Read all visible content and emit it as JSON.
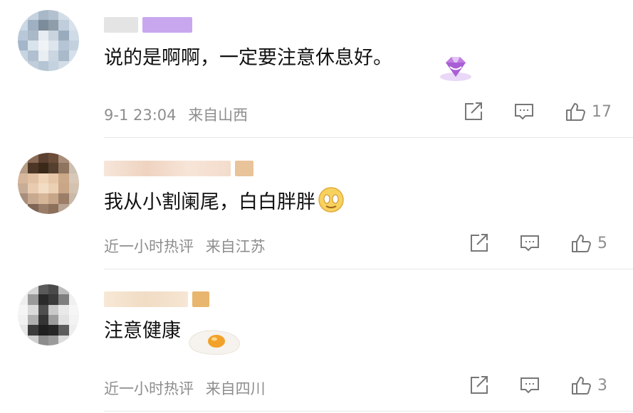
{
  "comments": [
    {
      "text": "说的是啊啊，一定要注意休息好。",
      "time": "9-1 23:04",
      "location": "来自山西",
      "likes": "17"
    },
    {
      "text": "我从小割阑尾，白白胖胖",
      "time": "近一小时热评",
      "location": "来自江苏",
      "likes": "5"
    },
    {
      "text": "注意健康",
      "time": "近一小时热评",
      "location": "来自四川",
      "likes": "3"
    }
  ],
  "icons": {
    "share": "share-icon",
    "reply": "comment-icon",
    "like": "thumbs-up-icon",
    "badge": "diamond-icon",
    "emoji1": "smiley-emoji-icon",
    "emoji2": "fried-egg-emoji-icon"
  },
  "colors": {
    "meta": "#8e8e8e",
    "divider": "#e7e7e7",
    "badge": "#c07de0"
  }
}
